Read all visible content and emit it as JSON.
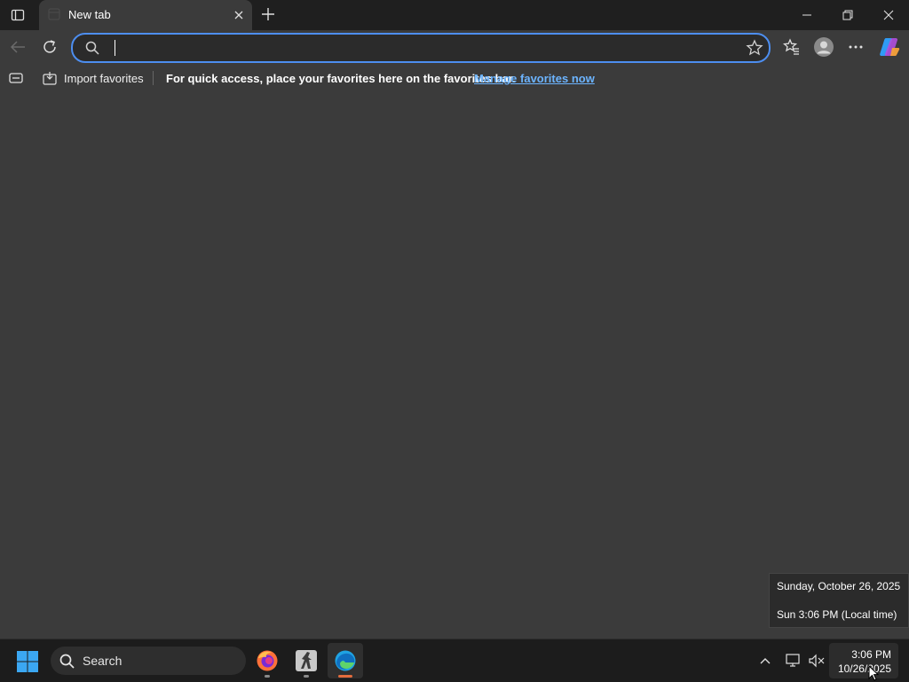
{
  "browser": {
    "tab": {
      "title": "New tab"
    },
    "address_bar": {
      "value": "",
      "placeholder": ""
    },
    "favorites_bar": {
      "import_label": "Import favorites",
      "message": "For quick access, place your favorites here on the favorites bar.",
      "manage_link": "Manage favorites now"
    }
  },
  "clock_tooltip": {
    "date_line": "Sunday, October 26, 2025",
    "time_line": "Sun 3:06 PM (Local time)"
  },
  "taskbar": {
    "search_label": "Search",
    "clock_time": "3:06 PM",
    "clock_date": "10/26/2025",
    "pinned_apps": [
      "firefox-icon",
      "counter-strike-icon",
      "edge-icon"
    ]
  },
  "colors": {
    "page_background": "#3b3b3b",
    "titlebar": "#1f1f1f",
    "address_focus": "#4d8ef0",
    "link": "#6cb4ff",
    "taskbar": "#1c1c1c",
    "active_indicator": "#e36c3d"
  }
}
